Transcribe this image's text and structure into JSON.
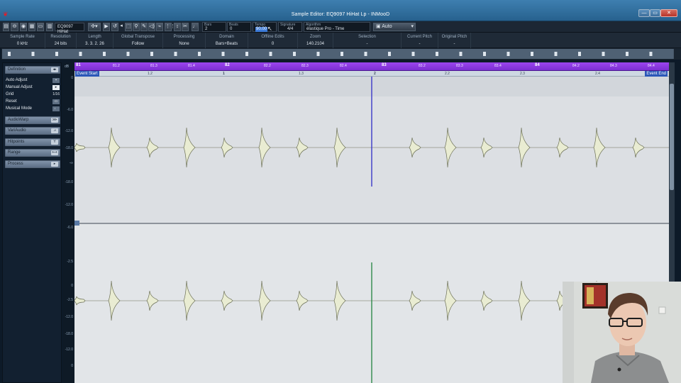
{
  "window": {
    "title": "Sample Editor: EQ9097 HiHat Lp - INMooD",
    "min_glyph": "—",
    "max_glyph": "▭",
    "close_glyph": "✕"
  },
  "toolbar": {
    "event_name": "EQ9097 HiHat",
    "bars": {
      "label": "Bars",
      "value": "2"
    },
    "beats": {
      "label": "Beats",
      "value": "0"
    },
    "tempo": {
      "label": "Tempo",
      "value": "90.00"
    },
    "signature": {
      "label": "Signature",
      "value": "4/4"
    },
    "algorithm": {
      "label": "Algorithm",
      "value": "élastique Pro - Time"
    },
    "auto_label": "Auto"
  },
  "infoline": {
    "columns": [
      {
        "label": "Sample Rate",
        "value": "0 kHz"
      },
      {
        "label": "Resolution",
        "value": "24 bits"
      },
      {
        "label": "Length",
        "value": "3. 3. 2. 26"
      },
      {
        "label": "Global Transpose",
        "value": "Follow"
      },
      {
        "label": "Processing",
        "value": "None"
      },
      {
        "label": "Domain",
        "value": "Bars+Beats"
      },
      {
        "label": "Offline Edits",
        "value": "0"
      },
      {
        "label": "Zoom",
        "value": "140.2104"
      },
      {
        "label": "Selection",
        "value": "-"
      },
      {
        "label": "Current Pitch",
        "value": "-"
      },
      {
        "label": "Original Pitch",
        "value": "-"
      }
    ]
  },
  "panel": {
    "definition": "Definition",
    "auto_adjust": "Auto Adjust",
    "manual_adjust": "Manual Adjust",
    "grid": "Grid",
    "grid_value": "1/16",
    "reset": "Reset",
    "musical_mode": "Musical Mode",
    "audiowarp": "AudioWarp",
    "variaudio": "VariAudio",
    "hitpoints": "Hitpoints",
    "range": "Range",
    "process": "Process"
  },
  "ruler": {
    "db_label": "dB",
    "bars": [
      "81",
      "82",
      "83",
      "84"
    ],
    "bar_sub": [
      "81.2",
      "81.3",
      "81.4",
      "82.2",
      "82.3",
      "82.4",
      "83.2",
      "83.3",
      "83.4",
      "84.2",
      "84.3",
      "84.4"
    ],
    "local_major": [
      "1",
      "2",
      "3"
    ],
    "local_sub": [
      "1.2",
      "1.3",
      "1.4",
      "2.2",
      "2.3",
      "2.4"
    ],
    "event_start": "Event Start",
    "event_end": "Event End"
  },
  "scale_ticks": [
    "0",
    "-6.0",
    "-12.0",
    "-18.0",
    "-∞",
    "-18.0",
    "-12.0",
    "-6.0",
    "-2.5",
    "0"
  ],
  "colors": {
    "ruler": "#8a3ae0",
    "wave_fill": "#e9ecd2",
    "wave_stroke": "#6b6f55",
    "cursor_top": "#3b38c8",
    "cursor_bottom": "#2f8a4a",
    "title_bar": "#2f6b9b",
    "close_button": "#c24a3e"
  }
}
